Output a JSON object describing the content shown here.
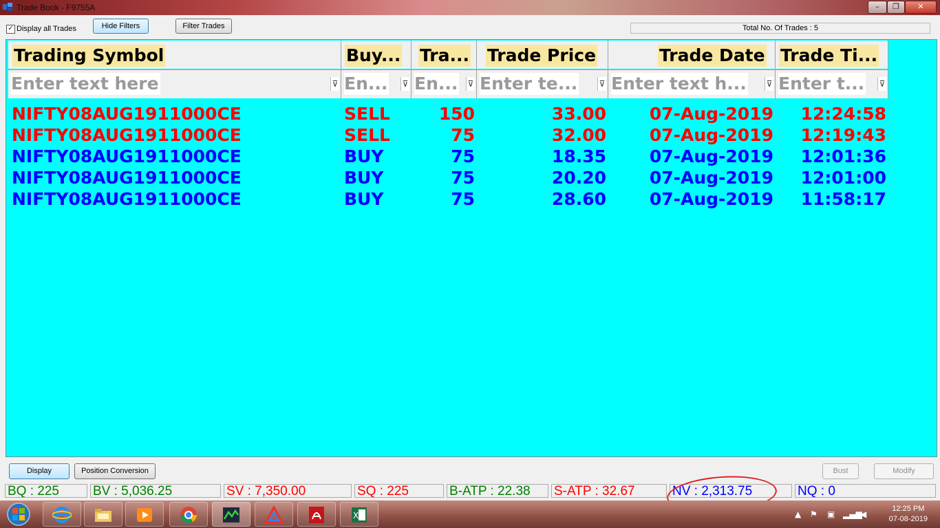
{
  "window": {
    "title": "Trade Book - F9755A",
    "controls": [
      "–",
      "❐",
      "✕"
    ]
  },
  "toolbar": {
    "display_all_label": "Display all Trades",
    "display_all_checked": true,
    "hide_filters_label": "Hide Filters",
    "filter_trades_label": "Filter Trades",
    "total_trades": "Total No. Of Trades : 5"
  },
  "grid": {
    "headers": [
      "Trading Symbol",
      "Buy...",
      "Tra...",
      "Trade Price",
      "Trade Date",
      "Trade Ti..."
    ],
    "filters": [
      "Enter text here",
      "En...",
      "En...",
      "Enter te...",
      "Enter text h...",
      "Enter t..."
    ],
    "rows": [
      {
        "symbol": "NIFTY08AUG1911000CE",
        "side": "SELL",
        "qty": "150",
        "price": "33.00",
        "date": "07-Aug-2019",
        "time": "12:24:58"
      },
      {
        "symbol": "NIFTY08AUG1911000CE",
        "side": "SELL",
        "qty": "75",
        "price": "32.00",
        "date": "07-Aug-2019",
        "time": "12:19:43"
      },
      {
        "symbol": "NIFTY08AUG1911000CE",
        "side": "BUY",
        "qty": "75",
        "price": "18.35",
        "date": "07-Aug-2019",
        "time": "12:01:36"
      },
      {
        "symbol": "NIFTY08AUG1911000CE",
        "side": "BUY",
        "qty": "75",
        "price": "20.20",
        "date": "07-Aug-2019",
        "time": "12:01:00"
      },
      {
        "symbol": "NIFTY08AUG1911000CE",
        "side": "BUY",
        "qty": "75",
        "price": "28.60",
        "date": "07-Aug-2019",
        "time": "11:58:17"
      }
    ],
    "colors": {
      "background": "#00ffff",
      "sell": "#ff0000",
      "buy": "#0000ff"
    }
  },
  "bottom": {
    "display_label": "Display",
    "position_conversion_label": "Position Conversion",
    "bust_label": "Bust",
    "modify_label": "Modify"
  },
  "status": {
    "bq": "BQ : 225",
    "bv": "BV : 5,036.25",
    "sv": "SV : 7,350.00",
    "sq": "SQ : 225",
    "batp": "B-ATP : 22.38",
    "satp": "S-ATP : 32.67",
    "nv": "NV : 2,313.75",
    "nq": "NQ : 0"
  },
  "taskbar": {
    "apps": [
      "internet-explorer-icon",
      "file-explorer-icon",
      "media-player-icon",
      "chrome-icon",
      "trading-app-icon",
      "delta-app-icon",
      "acrobat-icon",
      "excel-icon"
    ],
    "time": "12:25 PM",
    "date": "07-08-2019"
  }
}
